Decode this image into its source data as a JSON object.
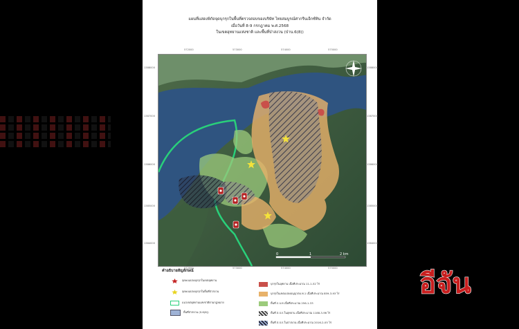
{
  "title": {
    "line1": "แผนที่แสดงพิกัดจุดบุกรุกในพื้นที่ตรวจสอบของบริษัท ไทยสมบูรณ์ศากรีนเอ็กซ์ทิน จำกัด",
    "line2": "เมื่อวันที่ 8-9 กรกฎาคม พ.ศ.2568",
    "line3": "ในเขตอุทยานแห่งชาติ และพื้นที่ป่าสงวน (ป่าน.6(8))"
  },
  "map": {
    "scale_labels": [
      "0",
      "1",
      "2 km"
    ],
    "top_ticks": [
      "572000",
      "573000",
      "574000",
      "575000"
    ],
    "bottom_ticks": [
      "572000",
      "573000",
      "574000",
      "575000"
    ],
    "left_ticks": [
      "1388000",
      "1387000",
      "1386000",
      "1385000",
      "1384000"
    ],
    "right_ticks": [
      "1388000",
      "1387000",
      "1386000",
      "1385000",
      "1384000"
    ],
    "colors": {
      "land": "#3f5a3c",
      "water": "#2a4e7a",
      "green_fill": "#9ccb7c",
      "orange_fill": "#e8b26a",
      "red_fill": "#c9504a",
      "boundary": "#29d07a",
      "hatch": "#3a3a4a"
    }
  },
  "legend": {
    "title": "คำอธิบายสัญลักษณ์",
    "left_items": [
      {
        "icon": "red-star-icon",
        "label": "จุดพบแปลงบุกรุกในเขตอุทยาน"
      },
      {
        "icon": "yellow-star-icon",
        "label": "จุดพบแปลงบุกรุกในพื้นที่ป่าสงวน"
      },
      {
        "icon": "green-outline-swatch",
        "label": "แนวเขตอุทยานแห่งชาติตามกฎหมาย"
      },
      {
        "icon": "blue-fill-swatch",
        "label": "พื้นที่ป่าสงวน (ป.6(8))"
      }
    ],
    "right_items": [
      {
        "icon": "red-fill-swatch",
        "label": "บุกรุกในอุทยาน เนื้อที่ประมาณ 11-1-52 ไร่"
      },
      {
        "icon": "orange-fill-swatch",
        "label": "บุกรุกในเขตแปลงอนุญาตบ.ท.1 เนื้อที่ประมาณ 859-3-93 ไร่"
      },
      {
        "icon": "green-fill-swatch",
        "label": "พื้นที่ ภ.บ.ท เนื้อที่ประมาณ 256-1-33"
      },
      {
        "icon": "hatch-swatch",
        "label": "พื้นที่ ส.ป.ก.ในอุทยาน เนื้อที่ประมาณ 1188-3-96 ไร่"
      },
      {
        "icon": "hatch-blue-swatch",
        "label": "พื้นที่ ส.ป.ก.ในป่าสงวน เนื้อที่ประมาณ 2016-2-05 ไร่"
      }
    ]
  },
  "watermark": {
    "text": "อีจัน"
  }
}
